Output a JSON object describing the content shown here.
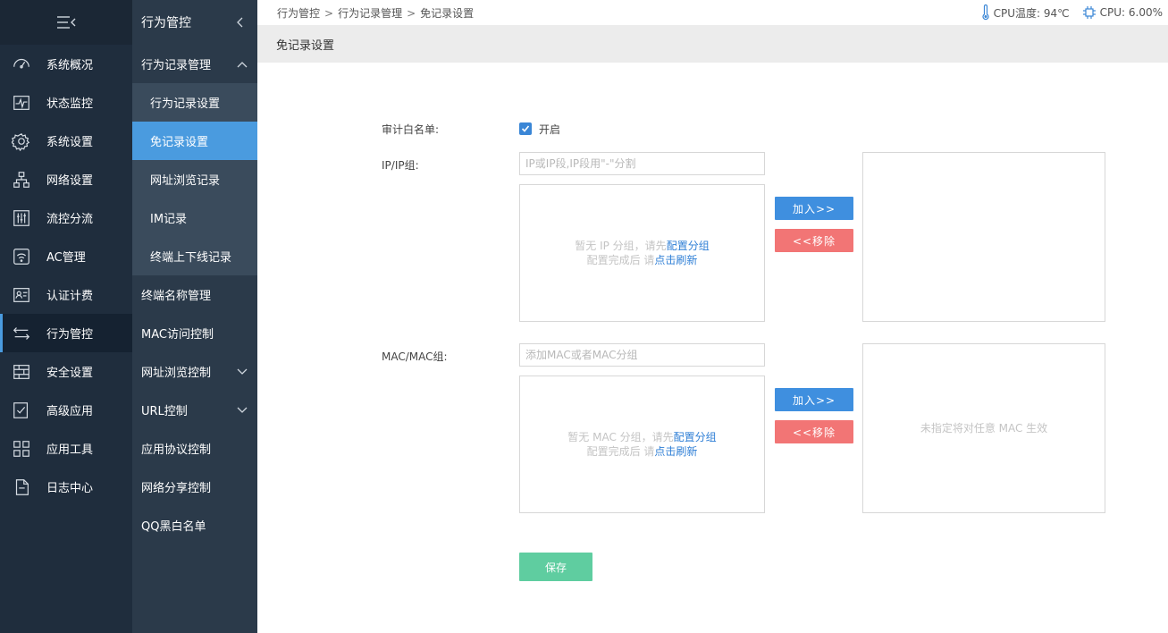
{
  "sidebar": {
    "items": [
      {
        "label": "系统概况",
        "icon": "dashboard-icon"
      },
      {
        "label": "状态监控",
        "icon": "monitor-icon"
      },
      {
        "label": "系统设置",
        "icon": "gear-icon"
      },
      {
        "label": "网络设置",
        "icon": "network-icon"
      },
      {
        "label": "流控分流",
        "icon": "sliders-icon"
      },
      {
        "label": "AC管理",
        "icon": "wifi-icon"
      },
      {
        "label": "认证计费",
        "icon": "id-card-icon"
      },
      {
        "label": "行为管控",
        "icon": "arrows-icon"
      },
      {
        "label": "安全设置",
        "icon": "firewall-icon"
      },
      {
        "label": "高级应用",
        "icon": "checklist-icon"
      },
      {
        "label": "应用工具",
        "icon": "grid-tools-icon"
      },
      {
        "label": "日志中心",
        "icon": "document-icon"
      }
    ]
  },
  "submenu": {
    "title": "行为管控",
    "group": "行为记录管理",
    "group_children": [
      "行为记录设置",
      "免记录设置",
      "网址浏览记录",
      "IM记录",
      "终端上下线记录"
    ],
    "rest": [
      "终端名称管理",
      "MAC访问控制",
      "网址浏览控制",
      "URL控制",
      "应用协议控制",
      "网络分享控制",
      "QQ黑白名单"
    ]
  },
  "breadcrumb": {
    "a": "行为管控",
    "b": "行为记录管理",
    "c": "免记录设置",
    "sep": ">"
  },
  "status": {
    "temp": "CPU温度: 94℃",
    "cpu": "CPU: 6.00%"
  },
  "page_title": "免记录设置",
  "form": {
    "whitelist_label": "审计白名单:",
    "whitelist_option": "开启",
    "ip_label": "IP/IP组:",
    "ip_placeholder": "IP或IP段,IP段用\"-\"分割",
    "ip_empty_1": "暂无 IP 分组，请先",
    "ip_empty_link1": "配置分组",
    "ip_empty_2": "配置完成后 请",
    "ip_empty_link2": "点击刷新",
    "mac_label": "MAC/MAC组:",
    "mac_placeholder": "添加MAC或者MAC分组",
    "mac_empty_1": "暂无 MAC 分组，请先",
    "mac_empty_link1": "配置分组",
    "mac_empty_2": "配置完成后 请",
    "mac_empty_link2": "点击刷新",
    "mac_right_note": "未指定将对任意 MAC 生效",
    "add": "加入>>",
    "remove": "<<移除",
    "save": "保存"
  }
}
